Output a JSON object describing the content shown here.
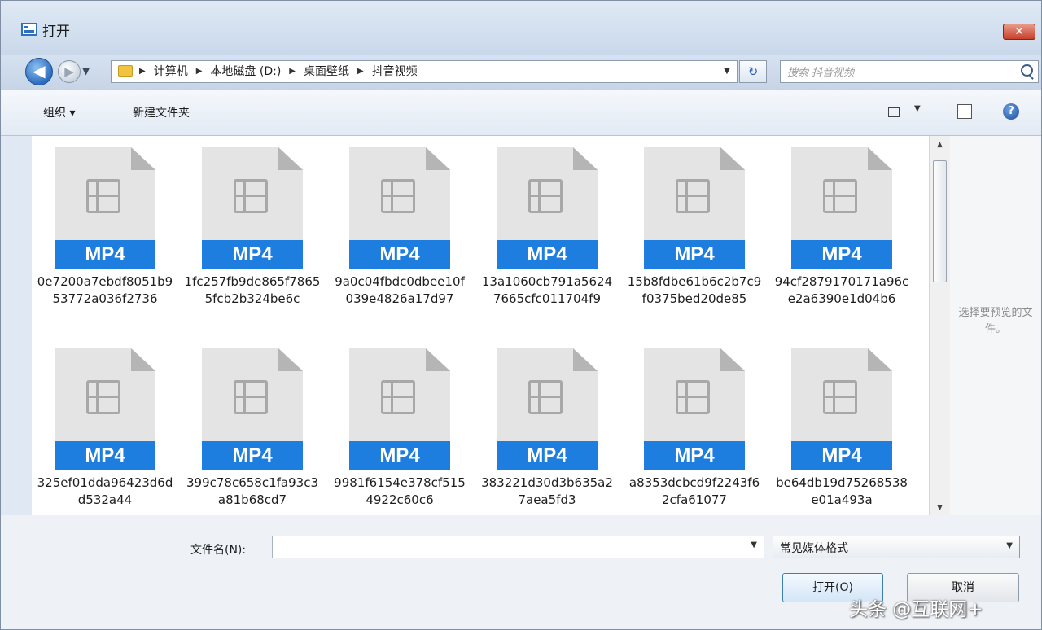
{
  "window": {
    "title": "打开",
    "close_glyph": "✕"
  },
  "nav": {
    "back_glyph": "◀",
    "forward_glyph": "▶",
    "breadcrumbs": [
      "计算机",
      "本地磁盘 (D:)",
      "桌面壁纸",
      "抖音视频"
    ],
    "refresh_glyph": "↻",
    "search_placeholder": "搜索 抖音视频"
  },
  "toolbar": {
    "organize": "组织 ▾",
    "new_folder": "新建文件夹"
  },
  "files": [
    {
      "type": "MP4",
      "name": "0e7200a7ebdf8051b953772a036f2736"
    },
    {
      "type": "MP4",
      "name": "1fc257fb9de865f78655fcb2b324be6c"
    },
    {
      "type": "MP4",
      "name": "9a0c04fbdc0dbee10f039e4826a17d97"
    },
    {
      "type": "MP4",
      "name": "13a1060cb791a56247665cfc011704f9"
    },
    {
      "type": "MP4",
      "name": "15b8fdbe61b6c2b7c9f0375bed20de85"
    },
    {
      "type": "MP4",
      "name": "94cf2879170171a96ce2a6390e1d04b6"
    },
    {
      "type": "MP4",
      "name": "325ef01dda96423d6dd532a44"
    },
    {
      "type": "MP4",
      "name": "399c78c658c1fa93c3a81b68cd7"
    },
    {
      "type": "MP4",
      "name": "9981f6154e378cf5154922c60c6"
    },
    {
      "type": "MP4",
      "name": "383221d30d3b635a27aea5fd3"
    },
    {
      "type": "MP4",
      "name": "a8353dcbcd9f2243f62cfa61077"
    },
    {
      "type": "MP4",
      "name": "be64db19d75268538e01a493a"
    }
  ],
  "preview": {
    "text": "选择要预览的文件。"
  },
  "bottom": {
    "filename_label": "文件名(N):",
    "filename_value": "",
    "filetype": "常见媒体格式",
    "open_button": "打开(O)",
    "cancel_button": "取消"
  },
  "watermark": "头条 @互联网+",
  "colors": {
    "mp4_badge": "#1e7ee0",
    "close": "#c7402a"
  }
}
